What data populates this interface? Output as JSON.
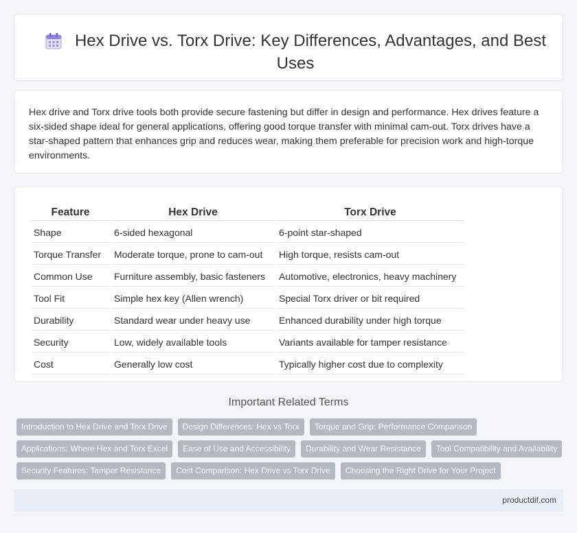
{
  "header": {
    "title": "Hex Drive vs. Torx Drive: Key Differences, Advantages, and Best Uses",
    "icon": "calendar-icon"
  },
  "intro": {
    "text": "Hex drive and Torx drive tools both provide secure fastening but differ in design and performance. Hex drives feature a six-sided shape ideal for general applications, offering good torque transfer with minimal cam-out. Torx drives have a star-shaped pattern that enhances grip and reduces wear, making them preferable for precision work and high-torque environments."
  },
  "table": {
    "headers": [
      "Feature",
      "Hex Drive",
      "Torx Drive"
    ],
    "rows": [
      [
        "Shape",
        "6-sided hexagonal",
        "6-point star-shaped"
      ],
      [
        "Torque Transfer",
        "Moderate torque, prone to cam-out",
        "High torque, resists cam-out"
      ],
      [
        "Common Use",
        "Furniture assembly, basic fasteners",
        "Automotive, electronics, heavy machinery"
      ],
      [
        "Tool Fit",
        "Simple hex key (Allen wrench)",
        "Special Torx driver or bit required"
      ],
      [
        "Durability",
        "Standard wear under heavy use",
        "Enhanced durability under high torque"
      ],
      [
        "Security",
        "Low, widely available tools",
        "Variants available for tamper resistance"
      ],
      [
        "Cost",
        "Generally low cost",
        "Typically higher cost due to complexity"
      ]
    ]
  },
  "related": {
    "title": "Important Related Terms",
    "rows": [
      [
        "Introduction to Hex Drive and Torx Drive",
        "Design Differences: Hex vs Torx",
        "Torque and Grip: Performance Comparison"
      ],
      [
        "Applications: Where Hex and Torx Excel",
        "Ease of Use and Accessibility",
        "Durability and Wear Resistance",
        "Tool Compatibility and Availability"
      ],
      [
        "Security Features: Tamper Resistance",
        "Cost Comparison: Hex Drive vs Torx Drive",
        "Choosing the Right Drive for Your Project"
      ]
    ]
  },
  "footer": {
    "text": "productdif.com"
  },
  "colors": {
    "tag_bg": "#b4b8c2",
    "footer_bg": "#e9eef8",
    "icon_accent": "#7b6fd6"
  }
}
